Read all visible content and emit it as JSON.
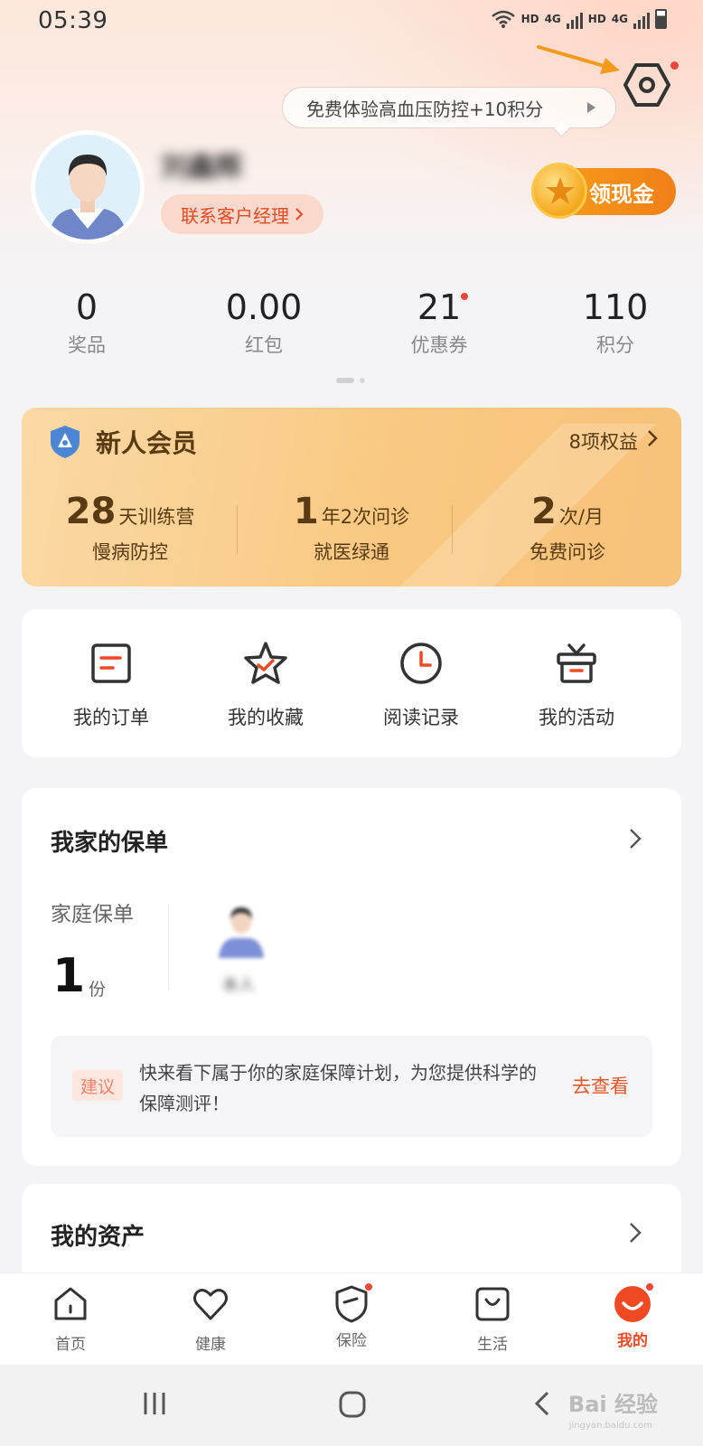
{
  "status_bar": {
    "time": "05:39",
    "hd1": "HD",
    "net1": "4G",
    "hd2": "HD",
    "net2": "4G"
  },
  "header": {
    "promo_text": "免费体验高血压防控+10积分",
    "username": "刘鑫辉",
    "contact_label": "联系客户经理",
    "cash_label": "领现金"
  },
  "stats": [
    {
      "value": "0",
      "label": "奖品"
    },
    {
      "value": "0.00",
      "label": "红包"
    },
    {
      "value": "21",
      "label": "优惠券"
    },
    {
      "value": "110",
      "label": "积分"
    }
  ],
  "member": {
    "title": "新人会员",
    "benefits": "8项权益",
    "cols": [
      {
        "num": "28",
        "unit": "天训练营",
        "sub": "慢病防控"
      },
      {
        "num": "1",
        "unit": "年2次问诊",
        "sub": "就医绿通"
      },
      {
        "num": "2",
        "unit": "次/月",
        "sub": "免费问诊"
      }
    ]
  },
  "quick_actions": [
    {
      "label": "我的订单",
      "icon": "order-icon"
    },
    {
      "label": "我的收藏",
      "icon": "favorites-icon"
    },
    {
      "label": "阅读记录",
      "icon": "clock-icon"
    },
    {
      "label": "我的活动",
      "icon": "gift-icon"
    }
  ],
  "policy": {
    "title": "我家的保单",
    "family_label": "家庭保单",
    "count": "1",
    "unit": "份",
    "member_name": "本人",
    "suggest_tag": "建议",
    "suggest_text": "快来看下属于你的家庭保障计划，为您提供科学的保障测评！",
    "suggest_link": "去查看"
  },
  "assets": {
    "title": "我的资产"
  },
  "tabs": [
    {
      "label": "首页",
      "icon": "home-icon"
    },
    {
      "label": "健康",
      "icon": "heart-icon"
    },
    {
      "label": "保险",
      "icon": "shield-icon"
    },
    {
      "label": "生活",
      "icon": "bag-icon"
    },
    {
      "label": "我的",
      "icon": "smile-icon"
    }
  ],
  "watermark": {
    "brand": "Bai 经验",
    "url": "jingyan.baidu.com"
  },
  "colors": {
    "accent": "#f04a25",
    "gold": "#f7a01b",
    "member_text": "#5a3a12",
    "badge": "#f0453a"
  }
}
